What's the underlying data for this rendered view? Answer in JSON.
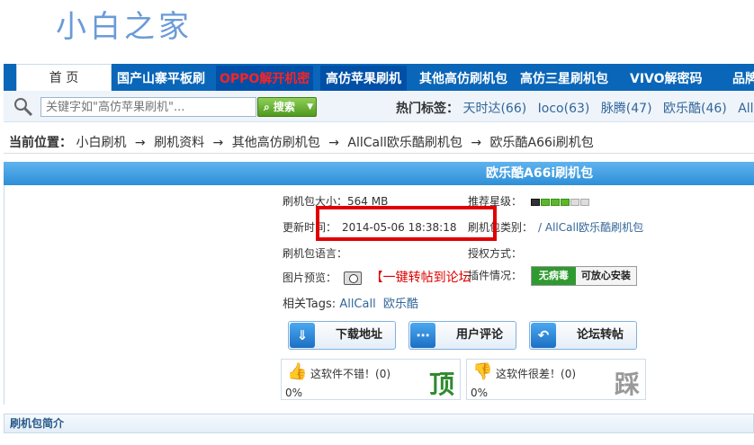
{
  "site": {
    "logo_text": "小白之家"
  },
  "nav": {
    "items": [
      {
        "label": "首 页"
      },
      {
        "label": "国产山寨平板刷"
      },
      {
        "label": "OPPO解开机密"
      },
      {
        "label": "高仿苹果刷机"
      },
      {
        "label": "其他高仿刷机包"
      },
      {
        "label": "高仿三星刷机包"
      },
      {
        "label": "VIVO解密码"
      },
      {
        "label": "品牌"
      }
    ]
  },
  "search": {
    "placeholder": "关键字如\"高仿苹果刷机\"...",
    "button_label": "搜索",
    "hot_tags_label": "热门标签：",
    "hot_tags": [
      "天时达(66)",
      "Ioco(63)",
      "脉腾(47)",
      "欧乐酷(46)",
      "AllC"
    ]
  },
  "breadcrumb": {
    "label": "当前位置：",
    "items": [
      "小白刷机",
      "刷机资料",
      "其他高仿刷机包",
      "AllCall欧乐酷刷机包",
      "欧乐酷A66i刷机包"
    ],
    "separator": "→"
  },
  "detail": {
    "title": "欧乐酷A66i刷机包",
    "size_label": "刷机包大小：",
    "size_value": "564 MB",
    "rating_label": "推荐星级：",
    "rating_level": 3,
    "rating_max": 5,
    "update_label": "更新时间：",
    "update_value": "2014-05-06 18:38:18",
    "category_label": "刷机包类别：",
    "category_value": "/ AllCall欧乐酷刷机包",
    "language_label": "刷机包语言：",
    "license_label": "授权方式：",
    "preview_label": "图片预览：",
    "repost_link": "【一键转帖到论坛",
    "plugin_label": "插件情况：",
    "badge_virus": "无病毒",
    "badge_safe": "可放心安装",
    "tags_label": "相关Tags:",
    "tags": [
      "AllCall",
      "欧乐酷"
    ]
  },
  "actions": {
    "download": "下载地址",
    "comments": "用户评论",
    "forum": "论坛转帖"
  },
  "votes": {
    "up_text": "这软件不错！",
    "up_count": "(0)",
    "up_pct": "0%",
    "up_big": "顶",
    "down_text": "这软件很差！",
    "down_count": "(0)",
    "down_pct": "0%",
    "down_big": "踩"
  },
  "intro": {
    "title": "刷机包简介"
  }
}
